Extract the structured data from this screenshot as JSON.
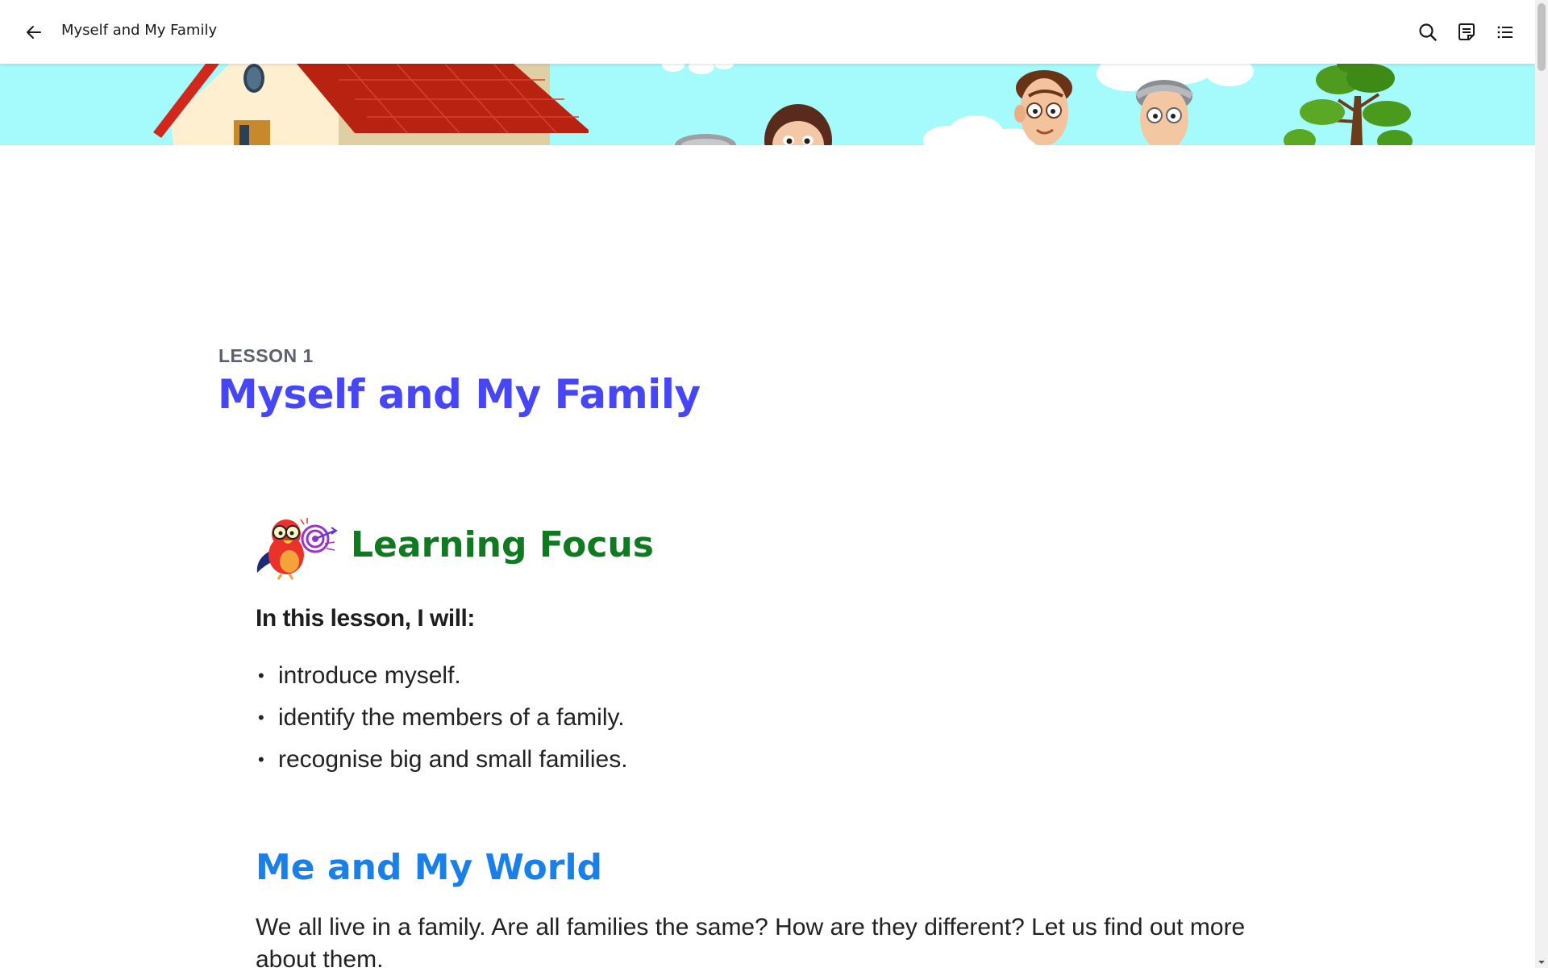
{
  "topbar": {
    "title": "Myself and My Family",
    "back_icon": "arrow-left-icon",
    "search_icon": "search-icon",
    "notes_icon": "notes-icon",
    "toc_icon": "list-icon"
  },
  "lesson": {
    "label": "LESSON 1",
    "title": "Myself and My Family"
  },
  "learning_focus": {
    "heading": "Learning Focus",
    "intro": "In this lesson, I will:",
    "items": [
      "introduce myself.",
      "identify the members of a family.",
      "recognise big and small families."
    ]
  },
  "section": {
    "heading": "Me and My World",
    "paragraph": "We all live in a family. Are all families the same? How are they different? Let us find out more about them."
  },
  "colors": {
    "lesson_title": "#4646f4",
    "focus_heading": "#107a21",
    "section_heading": "#1a80e8",
    "banner_sky": "#a5fafb"
  }
}
